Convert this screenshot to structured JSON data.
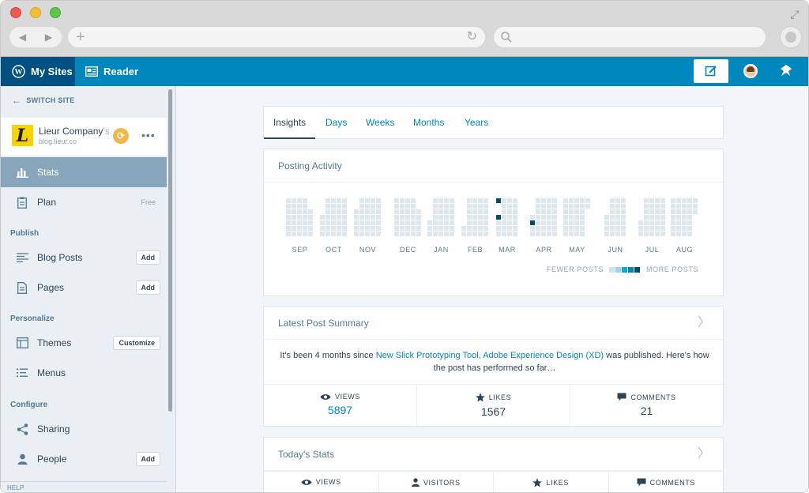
{
  "masterbar": {
    "my_sites": "My Sites",
    "reader": "Reader"
  },
  "sidebar": {
    "switch_site": "SWITCH SITE",
    "site_name": "Lieur Company",
    "site_name_fade": "'s",
    "site_url": "blog.lieur.co",
    "site_logo_letter": "L",
    "items": {
      "stats": "Stats",
      "plan": "Plan",
      "plan_tag": "Free",
      "blog_posts": "Blog Posts",
      "blog_posts_btn": "Add",
      "pages": "Pages",
      "pages_btn": "Add",
      "themes": "Themes",
      "themes_btn": "Customize",
      "menus": "Menus",
      "sharing": "Sharing",
      "people": "People",
      "people_btn": "Add"
    },
    "sections": {
      "publish": "Publish",
      "personalize": "Personalize",
      "configure": "Configure"
    },
    "help": "HELP"
  },
  "tabs": [
    "Insights",
    "Days",
    "Weeks",
    "Months",
    "Years"
  ],
  "posting_activity": {
    "title": "Posting Activity",
    "months": [
      "SEP",
      "OCT",
      "NOV",
      "DEC",
      "JAN",
      "FEB",
      "MAR",
      "APR",
      "MAY",
      "JUN",
      "JUL",
      "AUG"
    ],
    "legend_fewer": "FEWER POSTS",
    "legend_more": "MORE POSTS",
    "legend_colors": [
      "#c8e4f3",
      "#9fd1ec",
      "#00aadc",
      "#0087be",
      "#004d70"
    ],
    "empty_color": "#dde6ec",
    "active_days": [
      {
        "month": "MAR",
        "col": 0,
        "row": 0,
        "level": 4
      },
      {
        "month": "MAR",
        "col": 0,
        "row": 3,
        "level": 4
      },
      {
        "month": "APR",
        "col": 0,
        "row": 4,
        "level": 4
      }
    ]
  },
  "latest_post": {
    "title": "Latest Post Summary",
    "text_before": "It's been 4 months since ",
    "post_title": "New Slick Prototyping Tool, Adobe Experience Design (XD)",
    "text_after": " was published. Here's how the post has performed so far…",
    "stats": [
      {
        "label": "VIEWS",
        "value": "5897",
        "icon": "eye-icon"
      },
      {
        "label": "LIKES",
        "value": "1567",
        "icon": "star-icon"
      },
      {
        "label": "COMMENTS",
        "value": "21",
        "icon": "comment-icon"
      }
    ]
  },
  "today_stats": {
    "title": "Today's Stats",
    "labels": [
      "VIEWS",
      "VISITORS",
      "LIKES",
      "COMMENTS"
    ]
  },
  "colors": {
    "accent": "#0087be",
    "masterbar_dark": "#005082",
    "sidebar_active": "#87a6bc"
  }
}
